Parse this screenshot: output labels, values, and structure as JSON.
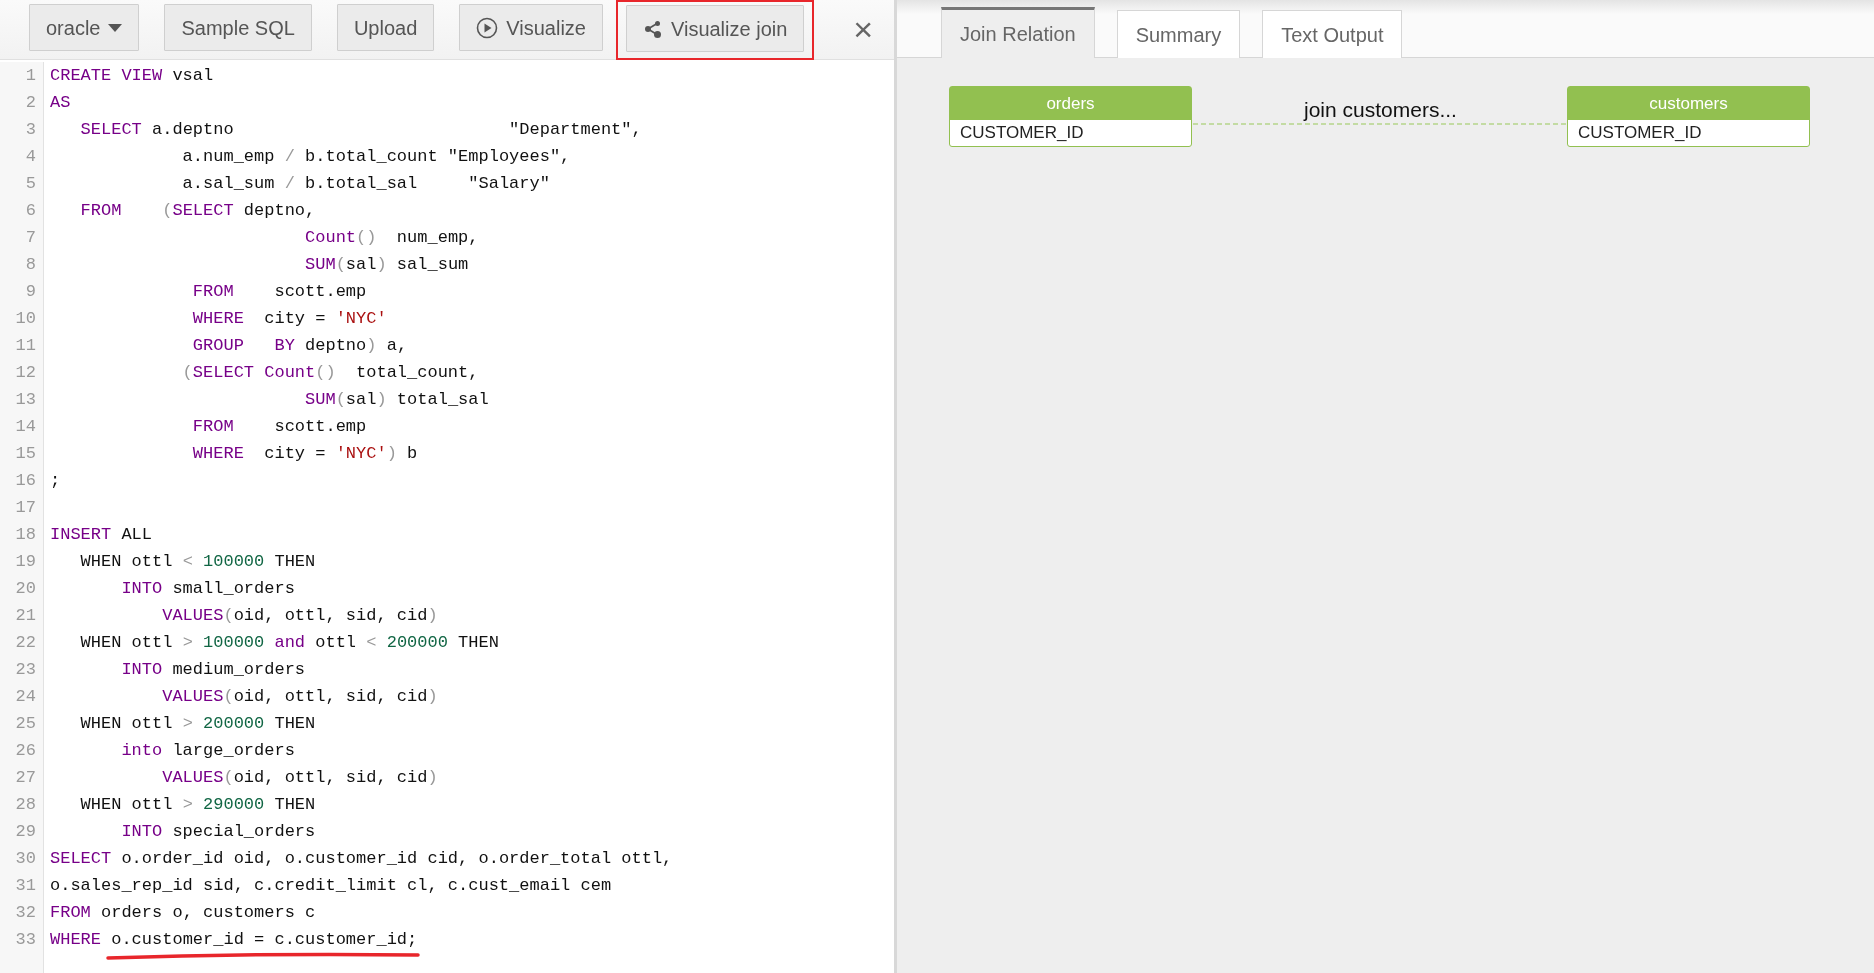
{
  "toolbar": {
    "buttons": [
      {
        "kind": "dropdown",
        "label": "oracle",
        "highlighted": false
      },
      {
        "kind": "plain",
        "label": "Sample SQL",
        "highlighted": false
      },
      {
        "kind": "plain",
        "label": "Upload",
        "highlighted": false
      },
      {
        "kind": "play",
        "label": "Visualize",
        "highlighted": false
      },
      {
        "kind": "share",
        "label": "Visualize join",
        "highlighted": true
      }
    ],
    "close": "×"
  },
  "editor": {
    "lines": [
      {
        "number": "1",
        "tokens": [
          {
            "kind": "keyword",
            "text": "CREATE VIEW"
          },
          {
            "kind": "plain",
            "text": " vsal"
          }
        ]
      },
      {
        "number": "2",
        "tokens": [
          {
            "kind": "keyword",
            "text": "AS"
          }
        ]
      },
      {
        "number": "3",
        "tokens": [
          {
            "kind": "keyword",
            "text": "   SELECT"
          },
          {
            "kind": "plain",
            "text": " a.deptno                           \"Department\","
          }
        ]
      },
      {
        "number": "4",
        "tokens": [
          {
            "kind": "plain",
            "text": "             a.num_emp "
          },
          {
            "kind": "operator",
            "text": "/"
          },
          {
            "kind": "plain",
            "text": " b.total_count \"Employees\","
          }
        ]
      },
      {
        "number": "5",
        "tokens": [
          {
            "kind": "plain",
            "text": "             a.sal_sum "
          },
          {
            "kind": "operator",
            "text": "/"
          },
          {
            "kind": "plain",
            "text": " b.total_sal     \"Salary\""
          }
        ]
      },
      {
        "number": "6",
        "tokens": [
          {
            "kind": "keyword",
            "text": "   FROM"
          },
          {
            "kind": "operator",
            "text": "    ("
          },
          {
            "kind": "keyword",
            "text": "SELECT"
          },
          {
            "kind": "plain",
            "text": " deptno,"
          }
        ]
      },
      {
        "number": "7",
        "tokens": [
          {
            "kind": "keyword",
            "text": "                         Count"
          },
          {
            "kind": "operator",
            "text": "()"
          },
          {
            "kind": "plain",
            "text": "  num_emp,"
          }
        ]
      },
      {
        "number": "8",
        "tokens": [
          {
            "kind": "keyword",
            "text": "                         SUM"
          },
          {
            "kind": "operator",
            "text": "("
          },
          {
            "kind": "plain",
            "text": "sal"
          },
          {
            "kind": "operator",
            "text": ")"
          },
          {
            "kind": "plain",
            "text": " sal_sum"
          }
        ]
      },
      {
        "number": "9",
        "tokens": [
          {
            "kind": "keyword",
            "text": "              FROM"
          },
          {
            "kind": "plain",
            "text": "    scott.emp"
          }
        ]
      },
      {
        "number": "10",
        "tokens": [
          {
            "kind": "keyword",
            "text": "              WHERE"
          },
          {
            "kind": "plain",
            "text": "  city = "
          },
          {
            "kind": "string",
            "text": "'NYC'"
          }
        ]
      },
      {
        "number": "11",
        "tokens": [
          {
            "kind": "keyword",
            "text": "              GROUP"
          },
          {
            "kind": "keyword",
            "text": "   BY"
          },
          {
            "kind": "plain",
            "text": " deptno"
          },
          {
            "kind": "operator",
            "text": ")"
          },
          {
            "kind": "plain",
            "text": " a,"
          }
        ]
      },
      {
        "number": "12",
        "tokens": [
          {
            "kind": "operator",
            "text": "             ("
          },
          {
            "kind": "keyword",
            "text": "SELECT Count"
          },
          {
            "kind": "operator",
            "text": "()"
          },
          {
            "kind": "plain",
            "text": "  total_count,"
          }
        ]
      },
      {
        "number": "13",
        "tokens": [
          {
            "kind": "keyword",
            "text": "                         SUM"
          },
          {
            "kind": "operator",
            "text": "("
          },
          {
            "kind": "plain",
            "text": "sal"
          },
          {
            "kind": "operator",
            "text": ")"
          },
          {
            "kind": "plain",
            "text": " total_sal"
          }
        ]
      },
      {
        "number": "14",
        "tokens": [
          {
            "kind": "keyword",
            "text": "              FROM"
          },
          {
            "kind": "plain",
            "text": "    scott.emp"
          }
        ]
      },
      {
        "number": "15",
        "tokens": [
          {
            "kind": "keyword",
            "text": "              WHERE"
          },
          {
            "kind": "plain",
            "text": "  city = "
          },
          {
            "kind": "string",
            "text": "'NYC'"
          },
          {
            "kind": "operator",
            "text": ")"
          },
          {
            "kind": "plain",
            "text": " b"
          }
        ]
      },
      {
        "number": "16",
        "tokens": [
          {
            "kind": "plain",
            "text": ";"
          }
        ]
      },
      {
        "number": "17"
      },
      {
        "number": "18",
        "tokens": [
          {
            "kind": "keyword",
            "text": "INSERT"
          },
          {
            "kind": "plain",
            "text": " ALL"
          }
        ]
      },
      {
        "number": "19",
        "tokens": [
          {
            "kind": "plain",
            "text": "   WHEN ottl "
          },
          {
            "kind": "operator",
            "text": "<"
          },
          {
            "kind": "number",
            "text": " 100000"
          },
          {
            "kind": "plain",
            "text": " THEN"
          }
        ]
      },
      {
        "number": "20",
        "tokens": [
          {
            "kind": "keyword",
            "text": "       INTO"
          },
          {
            "kind": "plain",
            "text": " small_orders"
          }
        ]
      },
      {
        "number": "21",
        "tokens": [
          {
            "kind": "keyword",
            "text": "           VALUES"
          },
          {
            "kind": "operator",
            "text": "("
          },
          {
            "kind": "plain",
            "text": "oid, ottl, sid, cid"
          },
          {
            "kind": "operator",
            "text": ")"
          }
        ]
      },
      {
        "number": "22",
        "tokens": [
          {
            "kind": "plain",
            "text": "   WHEN ottl "
          },
          {
            "kind": "operator",
            "text": ">"
          },
          {
            "kind": "number",
            "text": " 100000"
          },
          {
            "kind": "keyword",
            "text": " and"
          },
          {
            "kind": "plain",
            "text": " ottl "
          },
          {
            "kind": "operator",
            "text": "<"
          },
          {
            "kind": "number",
            "text": " 200000"
          },
          {
            "kind": "plain",
            "text": " THEN"
          }
        ]
      },
      {
        "number": "23",
        "tokens": [
          {
            "kind": "keyword",
            "text": "       INTO"
          },
          {
            "kind": "plain",
            "text": " medium_orders"
          }
        ]
      },
      {
        "number": "24",
        "tokens": [
          {
            "kind": "keyword",
            "text": "           VALUES"
          },
          {
            "kind": "operator",
            "text": "("
          },
          {
            "kind": "plain",
            "text": "oid, ottl, sid, cid"
          },
          {
            "kind": "operator",
            "text": ")"
          }
        ]
      },
      {
        "number": "25",
        "tokens": [
          {
            "kind": "plain",
            "text": "   WHEN ottl "
          },
          {
            "kind": "operator",
            "text": ">"
          },
          {
            "kind": "number",
            "text": " 200000"
          },
          {
            "kind": "plain",
            "text": " THEN"
          }
        ]
      },
      {
        "number": "26",
        "tokens": [
          {
            "kind": "keyword",
            "text": "       into"
          },
          {
            "kind": "plain",
            "text": " large_orders"
          }
        ]
      },
      {
        "number": "27",
        "tokens": [
          {
            "kind": "keyword",
            "text": "           VALUES"
          },
          {
            "kind": "operator",
            "text": "("
          },
          {
            "kind": "plain",
            "text": "oid, ottl, sid, cid"
          },
          {
            "kind": "operator",
            "text": ")"
          }
        ]
      },
      {
        "number": "28",
        "tokens": [
          {
            "kind": "plain",
            "text": "   WHEN ottl "
          },
          {
            "kind": "operator",
            "text": ">"
          },
          {
            "kind": "number",
            "text": " 290000"
          },
          {
            "kind": "plain",
            "text": " THEN"
          }
        ]
      },
      {
        "number": "29",
        "tokens": [
          {
            "kind": "keyword",
            "text": "       INTO"
          },
          {
            "kind": "plain",
            "text": " special_orders"
          }
        ]
      },
      {
        "number": "30",
        "tokens": [
          {
            "kind": "keyword",
            "text": "SELECT"
          },
          {
            "kind": "plain",
            "text": " o.order_id oid, o.customer_id cid, o.order_total ottl,"
          }
        ]
      },
      {
        "number": "31",
        "tokens": [
          {
            "kind": "plain",
            "text": "o.sales_rep_id sid, c.credit_limit cl, c.cust_email cem"
          }
        ]
      },
      {
        "number": "32",
        "tokens": [
          {
            "kind": "keyword",
            "text": "FROM"
          },
          {
            "kind": "plain",
            "text": " orders o, customers c"
          }
        ]
      },
      {
        "number": "33",
        "tokens": [
          {
            "kind": "keyword",
            "text": "WHERE "
          },
          {
            "kind": "plain",
            "text": "o.customer_id = c.customer_id;",
            "underlined": true
          }
        ]
      }
    ]
  },
  "tabs": [
    {
      "label": "Join Relation",
      "selected": true
    },
    {
      "label": "Summary",
      "selected": false
    },
    {
      "label": "Text Output",
      "selected": false
    }
  ],
  "diagram": {
    "tables": [
      {
        "name": "orders",
        "columns": [
          "CUSTOMER_ID"
        ]
      },
      {
        "name": "customers",
        "columns": [
          "CUSTOMER_ID"
        ]
      }
    ],
    "joins": [
      {
        "label": "join customers..."
      }
    ]
  }
}
